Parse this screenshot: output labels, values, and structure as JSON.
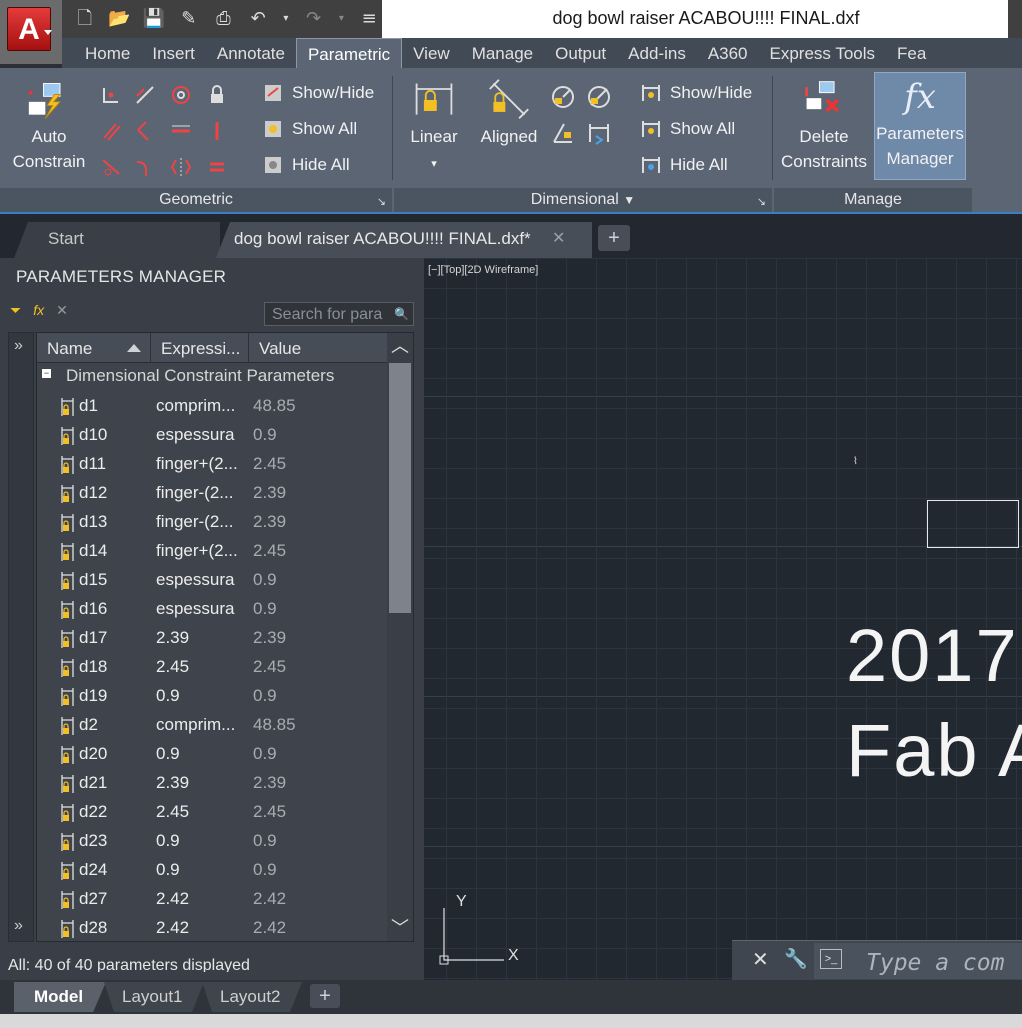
{
  "window": {
    "title": "dog bowl raiser ACABOU!!!! FINAL.dxf",
    "app_letter": "A"
  },
  "ribbon_tabs": [
    "Home",
    "Insert",
    "Annotate",
    "Parametric",
    "View",
    "Manage",
    "Output",
    "Add-ins",
    "A360",
    "Express Tools",
    "Fea"
  ],
  "active_ribbon_tab": "Parametric",
  "ribbon": {
    "geometric": {
      "title": "Geometric",
      "auto_constrain_line1": "Auto",
      "auto_constrain_line2": "Constrain",
      "show_hide": "Show/Hide",
      "show_all": "Show All",
      "hide_all": "Hide All"
    },
    "dimensional": {
      "title": "Dimensional",
      "linear": "Linear",
      "aligned": "Aligned",
      "show_hide": "Show/Hide",
      "show_all": "Show All",
      "hide_all": "Hide All"
    },
    "manage": {
      "title": "Manage",
      "delete_line1": "Delete",
      "delete_line2": "Constraints",
      "pm_line1": "Parameters",
      "pm_line2": "Manager"
    }
  },
  "doc_tabs": {
    "start": "Start",
    "current": "dog bowl raiser ACABOU!!!! FINAL.dxf*"
  },
  "parameters_manager": {
    "title": "PARAMETERS MANAGER",
    "search_placeholder": "Search for para",
    "columns": [
      "Name",
      "Expressi...",
      "Value"
    ],
    "group": "Dimensional Constraint Parameters",
    "rows": [
      {
        "name": "d1",
        "expr": "comprim...",
        "value": "48.85"
      },
      {
        "name": "d10",
        "expr": "espessura",
        "value": "0.9"
      },
      {
        "name": "d11",
        "expr": "finger+(2...",
        "value": "2.45"
      },
      {
        "name": "d12",
        "expr": "finger-(2...",
        "value": "2.39"
      },
      {
        "name": "d13",
        "expr": "finger-(2...",
        "value": "2.39"
      },
      {
        "name": "d14",
        "expr": "finger+(2...",
        "value": "2.45"
      },
      {
        "name": "d15",
        "expr": "espessura",
        "value": "0.9"
      },
      {
        "name": "d16",
        "expr": "espessura",
        "value": "0.9"
      },
      {
        "name": "d17",
        "expr": "2.39",
        "value": "2.39"
      },
      {
        "name": "d18",
        "expr": "2.45",
        "value": "2.45"
      },
      {
        "name": "d19",
        "expr": "0.9",
        "value": "0.9"
      },
      {
        "name": "d2",
        "expr": "comprim...",
        "value": "48.85"
      },
      {
        "name": "d20",
        "expr": "0.9",
        "value": "0.9"
      },
      {
        "name": "d21",
        "expr": "2.39",
        "value": "2.39"
      },
      {
        "name": "d22",
        "expr": "2.45",
        "value": "2.45"
      },
      {
        "name": "d23",
        "expr": "0.9",
        "value": "0.9"
      },
      {
        "name": "d24",
        "expr": "0.9",
        "value": "0.9"
      },
      {
        "name": "d27",
        "expr": "2.42",
        "value": "2.42"
      },
      {
        "name": "d28",
        "expr": "2.42",
        "value": "2.42"
      }
    ],
    "status": "All: 40 of 40 parameters displayed"
  },
  "viewport": {
    "label": "[−][Top][2D Wireframe]",
    "text_line1": "2017",
    "text_line2": "Fab A",
    "axis_y": "Y",
    "axis_x": "X"
  },
  "command_line": {
    "placeholder": "Type a com"
  },
  "layout_tabs": [
    "Model",
    "Layout1",
    "Layout2"
  ],
  "active_layout_tab": "Model",
  "colors": {
    "accent": "#3a7fc1",
    "canvas": "#212830",
    "logo_red": "#d42a2a"
  }
}
